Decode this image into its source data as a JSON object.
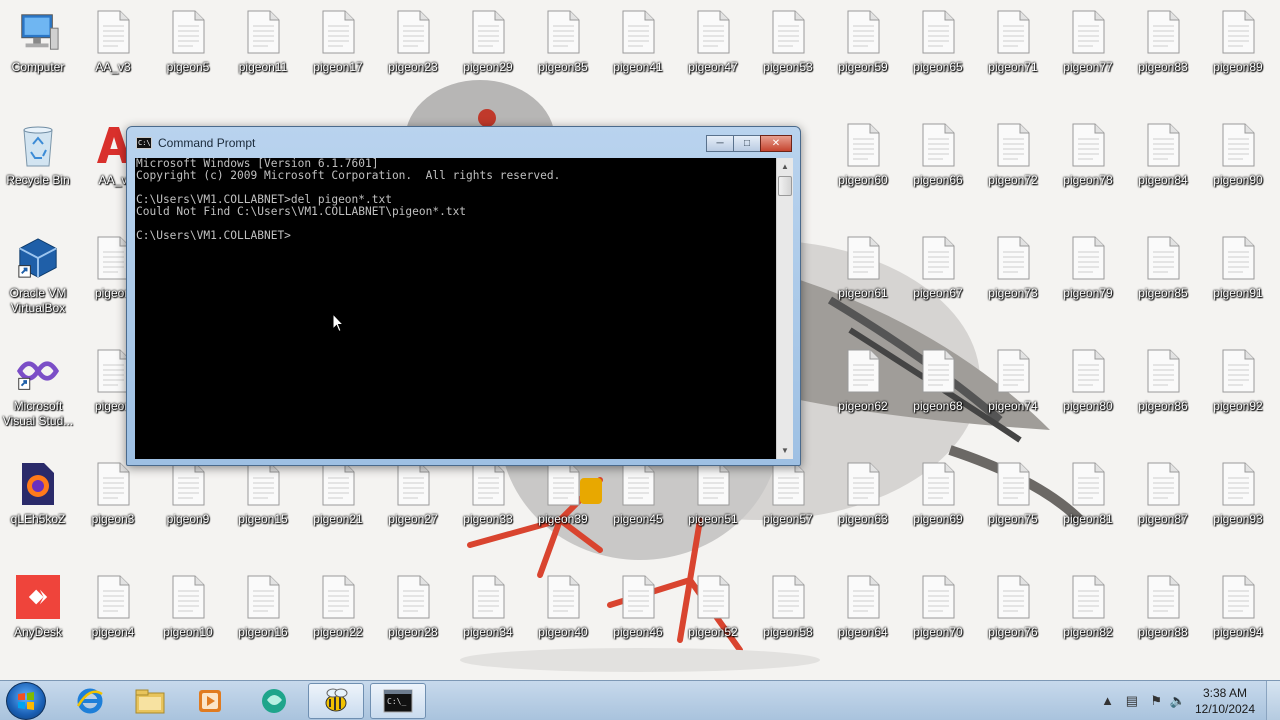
{
  "desktop": {
    "icons": [
      {
        "label": "Computer",
        "type": "computer"
      },
      {
        "label": "AA_v3",
        "type": "file"
      },
      {
        "label": "pigeon5",
        "type": "file"
      },
      {
        "label": "pigeon11",
        "type": "file"
      },
      {
        "label": "pigeon17",
        "type": "file"
      },
      {
        "label": "pigeon23",
        "type": "file"
      },
      {
        "label": "pigeon29",
        "type": "file"
      },
      {
        "label": "pigeon35",
        "type": "file"
      },
      {
        "label": "pigeon41",
        "type": "file"
      },
      {
        "label": "pigeon47",
        "type": "file"
      },
      {
        "label": "pigeon53",
        "type": "file"
      },
      {
        "label": "pigeon59",
        "type": "file"
      },
      {
        "label": "pigeon65",
        "type": "file"
      },
      {
        "label": "pigeon71",
        "type": "file"
      },
      {
        "label": "pigeon77",
        "type": "file"
      },
      {
        "label": "pigeon83",
        "type": "file"
      },
      {
        "label": "pigeon89",
        "type": "file"
      },
      {
        "label": "Recycle Bin",
        "type": "recycle"
      },
      {
        "label": "AA_v",
        "type": "app-red"
      },
      {
        "label": "pigeon60",
        "type": "file"
      },
      {
        "label": "pigeon66",
        "type": "file"
      },
      {
        "label": "pigeon72",
        "type": "file"
      },
      {
        "label": "pigeon78",
        "type": "file"
      },
      {
        "label": "pigeon84",
        "type": "file"
      },
      {
        "label": "pigeon90",
        "type": "file"
      },
      {
        "label": "Oracle VM VirtualBox",
        "type": "virtualbox"
      },
      {
        "label": "pigeon",
        "type": "file"
      },
      {
        "label": "pigeon61",
        "type": "file"
      },
      {
        "label": "pigeon67",
        "type": "file"
      },
      {
        "label": "pigeon73",
        "type": "file"
      },
      {
        "label": "pigeon79",
        "type": "file"
      },
      {
        "label": "pigeon85",
        "type": "file"
      },
      {
        "label": "pigeon91",
        "type": "file"
      },
      {
        "label": "Microsoft Visual Stud...",
        "type": "visualstudio"
      },
      {
        "label": "pigeon",
        "type": "file"
      },
      {
        "label": "pigeon62",
        "type": "file"
      },
      {
        "label": "pigeon68",
        "type": "file"
      },
      {
        "label": "pigeon74",
        "type": "file"
      },
      {
        "label": "pigeon80",
        "type": "file"
      },
      {
        "label": "pigeon86",
        "type": "file"
      },
      {
        "label": "pigeon92",
        "type": "file"
      },
      {
        "label": "qLEh5koZ",
        "type": "firefox"
      },
      {
        "label": "pigeon3",
        "type": "file"
      },
      {
        "label": "pigeon9",
        "type": "file"
      },
      {
        "label": "pigeon15",
        "type": "file"
      },
      {
        "label": "pigeon21",
        "type": "file"
      },
      {
        "label": "pigeon27",
        "type": "file"
      },
      {
        "label": "pigeon33",
        "type": "file"
      },
      {
        "label": "pigeon39",
        "type": "file"
      },
      {
        "label": "pigeon45",
        "type": "file"
      },
      {
        "label": "pigeon51",
        "type": "file"
      },
      {
        "label": "pigeon57",
        "type": "file"
      },
      {
        "label": "pigeon63",
        "type": "file"
      },
      {
        "label": "pigeon69",
        "type": "file"
      },
      {
        "label": "pigeon75",
        "type": "file"
      },
      {
        "label": "pigeon81",
        "type": "file"
      },
      {
        "label": "pigeon87",
        "type": "file"
      },
      {
        "label": "pigeon93",
        "type": "file"
      },
      {
        "label": "AnyDesk",
        "type": "anydesk"
      },
      {
        "label": "pigeon4",
        "type": "file"
      },
      {
        "label": "pigeon10",
        "type": "file"
      },
      {
        "label": "pigeon16",
        "type": "file"
      },
      {
        "label": "pigeon22",
        "type": "file"
      },
      {
        "label": "pigeon28",
        "type": "file"
      },
      {
        "label": "pigeon34",
        "type": "file"
      },
      {
        "label": "pigeon40",
        "type": "file"
      },
      {
        "label": "pigeon46",
        "type": "file"
      },
      {
        "label": "pigeon52",
        "type": "file"
      },
      {
        "label": "pigeon58",
        "type": "file"
      },
      {
        "label": "pigeon64",
        "type": "file"
      },
      {
        "label": "pigeon70",
        "type": "file"
      },
      {
        "label": "pigeon76",
        "type": "file"
      },
      {
        "label": "pigeon82",
        "type": "file"
      },
      {
        "label": "pigeon88",
        "type": "file"
      },
      {
        "label": "pigeon94",
        "type": "file"
      }
    ]
  },
  "cmd_window": {
    "title": "Command Prompt",
    "lines": [
      "Microsoft Windows [Version 6.1.7601]",
      "Copyright (c) 2009 Microsoft Corporation.  All rights reserved.",
      "",
      "C:\\Users\\VM1.COLLABNET>del pigeon*.txt",
      "Could Not Find C:\\Users\\VM1.COLLABNET\\pigeon*.txt",
      "",
      "C:\\Users\\VM1.COLLABNET>"
    ],
    "icon_name": "cmd-icon"
  },
  "taskbar": {
    "items": [
      {
        "name": "internet-explorer-icon"
      },
      {
        "name": "file-explorer-icon"
      },
      {
        "name": "media-player-icon"
      },
      {
        "name": "chat-app-icon"
      },
      {
        "name": "bee-app-icon",
        "active": true
      },
      {
        "name": "cmd-icon",
        "active": true
      }
    ],
    "clock": {
      "time": "3:38 AM",
      "date": "12/10/2024"
    }
  },
  "colors": {
    "console_bg": "#000000",
    "console_fg": "#c0c0c0",
    "taskbar": "#b8cde3"
  }
}
